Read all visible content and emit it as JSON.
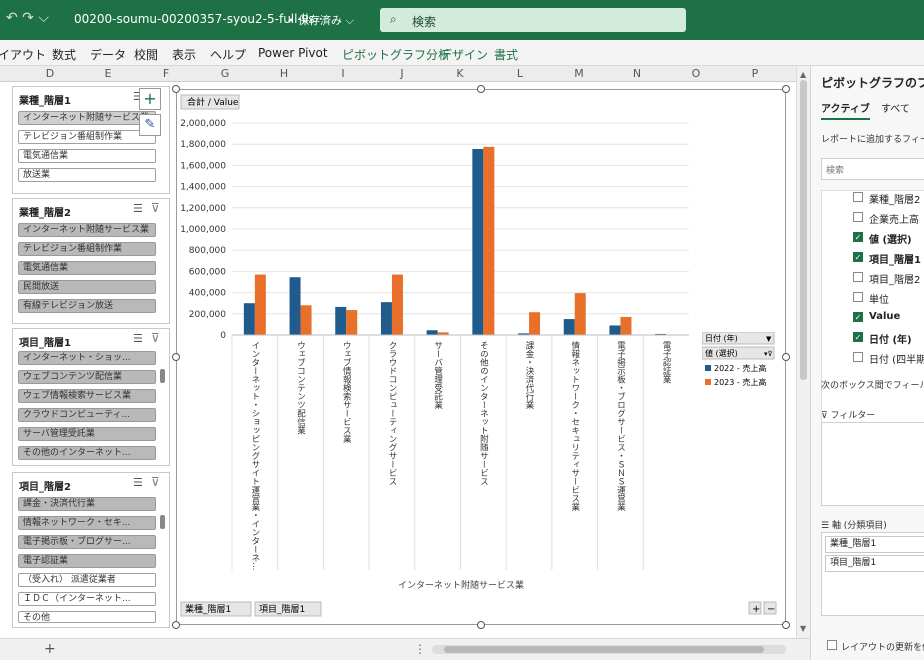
{
  "titlebar": {
    "qa_icons": "↶ ↷ ⌵",
    "filename": "00200-soumu-00200357-syou2-5-full-lis···",
    "saved": "• 保存済み ⌵",
    "search_placeholder": "検索"
  },
  "menu": [
    "イアウト",
    "数式",
    "データ",
    "校閲",
    "表示",
    "ヘルプ",
    "Power Pivot",
    "ピボットグラフ分析",
    "デザイン",
    "書式"
  ],
  "columns": [
    "D",
    "E",
    "F",
    "G",
    "H",
    "I",
    "J",
    "K",
    "L",
    "M",
    "N",
    "O",
    "P"
  ],
  "slicers": [
    {
      "title": "業種_階層1",
      "items": [
        "インターネット附随サービス業",
        "テレビジョン番組制作業",
        "電気通信業",
        "放送業"
      ]
    },
    {
      "title": "業種_階層2",
      "items": [
        "インターネット附随サービス業",
        "テレビジョン番組制作業",
        "電気通信業",
        "民間放送",
        "有線テレビジョン放送"
      ]
    },
    {
      "title": "項目_階層1",
      "items": [
        "インターネット・ショッ...",
        "ウェブコンテンツ配信業",
        "ウェブ情報検索サービス業",
        "クラウドコンピューティ...",
        "サーバ管理受託業",
        "その他のインターネット..."
      ]
    },
    {
      "title": "項目_階層2",
      "items": [
        "課金・決済代行業",
        "情報ネットワーク・セキ...",
        "電子掲示板・ブログサー...",
        "電子認証業",
        "（受入れ） 派遣従業者",
        "ＩＤＣ（インターネット...",
        "その他"
      ]
    }
  ],
  "chart_data": {
    "type": "bar",
    "title": "合計 / Value",
    "xlabel": "インターネット附随サービス業",
    "ylim": [
      0,
      2000000
    ],
    "yticks": [
      "2,000,000",
      "1,800,000",
      "1,600,000",
      "1,400,000",
      "1,200,000",
      "1,000,000",
      "800,000",
      "600,000",
      "400,000",
      "200,000",
      "0"
    ],
    "categories": [
      "インターネット・ショッピングサイト運営業・インターネット・オークションサイト運営業",
      "ウェブコンテンツ配信業",
      "ウェブ情報検索サービス業",
      "クラウドコンピューティングサービス",
      "サーバ管理受託業",
      "その他のインターネット附随サービス",
      "課金・決済代行業",
      "情報ネットワーク・セキュリティサービス業",
      "電子掲示板・ブログサービス・ＳＮＳ運営業",
      "電子認証業"
    ],
    "series": [
      {
        "name": "2022 - 売上高",
        "color": "#1f5b8c",
        "values": [
          300000,
          545000,
          265000,
          310000,
          45000,
          1755000,
          15000,
          150000,
          90000,
          10000
        ]
      },
      {
        "name": "2023 - 売上高",
        "color": "#e8702a",
        "values": [
          570000,
          280000,
          235000,
          570000,
          25000,
          1775000,
          215000,
          395000,
          170000,
          5000
        ]
      }
    ],
    "legend_title": "値 (選択)",
    "filter_label": "日付 (年)",
    "axis_buttons": [
      "業種_階層1",
      "項目_階層1"
    ]
  },
  "pane": {
    "title": "ピボットグラフのフィー",
    "tab_active": "アクティブ",
    "tab_all": "すべて",
    "add_label": "レポートに追加するフィール",
    "search_placeholder": "検索",
    "fields": [
      {
        "label": "業種_階層2",
        "on": false
      },
      {
        "label": "企業売上高",
        "on": false
      },
      {
        "label": "値 (選択)",
        "on": true
      },
      {
        "label": "項目_階層1",
        "on": true
      },
      {
        "label": "項目_階層2",
        "on": false
      },
      {
        "label": "単位",
        "on": false
      },
      {
        "label": "Value",
        "on": true
      },
      {
        "label": "日付 (年)",
        "on": true
      },
      {
        "label": "日付 (四半期)",
        "on": false
      }
    ],
    "drag_label": "次のボックス間でフィールド",
    "filter_label": "フィルター",
    "axis_label": "軸 (分類項目)",
    "axis_items": [
      "業種_階層1",
      "項目_階層1"
    ],
    "defer_label": "レイアウトの更新を保"
  },
  "statusbar": {
    "add": "+",
    "dots": "⋮"
  }
}
